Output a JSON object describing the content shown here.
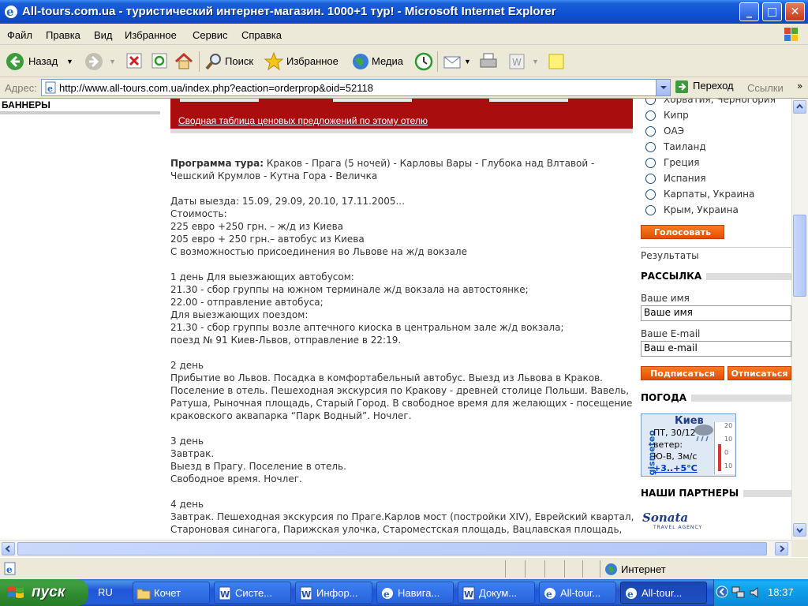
{
  "window": {
    "title": "All-tours.com.ua - туристический интернет-магазин. 1000+1 тур! - Microsoft Internet Explorer",
    "min_label": "_",
    "max_label": "□",
    "close_label": "✕"
  },
  "menu": [
    "Файл",
    "Правка",
    "Вид",
    "Избранное",
    "Сервис",
    "Справка"
  ],
  "toolbar": {
    "back_label": "Назад",
    "search_label": "Поиск",
    "favorites_label": "Избранное",
    "media_label": "Медиа"
  },
  "address": {
    "label": "Адрес:",
    "url": "http://www.all-tours.com.ua/index.php?eaction=orderprop&oid=52118",
    "go_label": "Переход",
    "links_label": "Ссылки"
  },
  "banners": {
    "header": "БАННЕРЫ"
  },
  "offer_link": "Сводная таблица ценовых предложений по этому отелю",
  "program": {
    "title_bold": "Программа тура:",
    "route": "Краков - Прага (5 ночей) - Карловы Вары - Глубока над Влтавой - Чешский Крумлов - Кутна Гора - Величка",
    "p1": [
      "Даты выезда: 15.09, 29.09, 20.10, 17.11.2005...",
      "Стоимость:",
      "225 евро +250 грн. – ж/д из Киева",
      "205 евро + 250 грн.– автобус из Киева",
      "С возможностью присоединения во Львове на ж/д вокзале"
    ],
    "p2": [
      "1 день Для выезжающих автобусом:",
      "21.30 - сбор группы на южном терминале ж/д вокзала на автостоянке;",
      "22.00 - отправление автобуса;",
      "Для выезжающих поездом:",
      "21.30 - сбор группы возле аптечного киоска в центральном зале ж/д вокзала;",
      "поезд № 91 Киев-Львов, отправление в 22:19."
    ],
    "p3_head": "2 день",
    "p3_body": "Прибытие во Львов. Посадка в комфортабельный автобус. Выезд из Львова в Краков. Поселение в отель. Пешеходная экскурсия по Кракову - древней столице Польши. Вавель, Ратуша, Рыночная площадь, Старый Город. В свободное время для желающих - посещение краковского аквапарка “Парк Водный”. Ночлег.",
    "p4": [
      "3 день",
      "Завтрак.",
      "Выезд в Прагу. Поселение в отель.",
      "Свободное время. Ночлег."
    ],
    "p5_head": "4 день",
    "p5_body": "Завтрак. Пешеходная экскурсия по Праге.Карлов мост (постройки XIV), Еврейский квартал, Староновая синагога, Парижская улочка, Староместская площадь, Вацлавская площадь,"
  },
  "poll": {
    "partial_option": "Хорватия, Черногория",
    "options": [
      "Кипр",
      "ОАЭ",
      "Таиланд",
      "Греция",
      "Испания",
      "Карпаты, Украина",
      "Крым, Украина"
    ],
    "vote_label": "Голосовать",
    "results_label": "Результаты"
  },
  "newsletter": {
    "header": "РАССЫЛКА",
    "name_label": "Ваше имя",
    "name_value": "Ваше имя",
    "email_label": "Ваше E-mail",
    "email_value": "Ваш e-mail",
    "subscribe_label": "Подписаться",
    "unsubscribe_label": "Отписаться"
  },
  "weather": {
    "header": "ПОГОДА",
    "city": "Киев",
    "brand": "gismeteo",
    "date": "ПТ, 30/12",
    "wind_label": "ветер:",
    "wind": "Ю-В, 3м/с",
    "temp": "+3..+5°C",
    "scale": [
      "20",
      "10",
      "0",
      "10"
    ]
  },
  "partners": {
    "header": "НАШИ ПАРТНЕРЫ",
    "logo_text": "Sonata",
    "logo_sub": "TRAVEL AGENCY"
  },
  "status": {
    "zone": "Интернет"
  },
  "taskbar": {
    "start_label": "пуск",
    "lang": "RU",
    "tasks": [
      "Кочет",
      "Систе...",
      "Инфор...",
      "Навига...",
      "Докум...",
      "All-tour...",
      "All-tour..."
    ],
    "clock": "18:37"
  },
  "colors": {
    "accent_red": "#aa0d0d",
    "button_orange": "#f0620f",
    "titlebar_blue": "#0f52d3"
  }
}
